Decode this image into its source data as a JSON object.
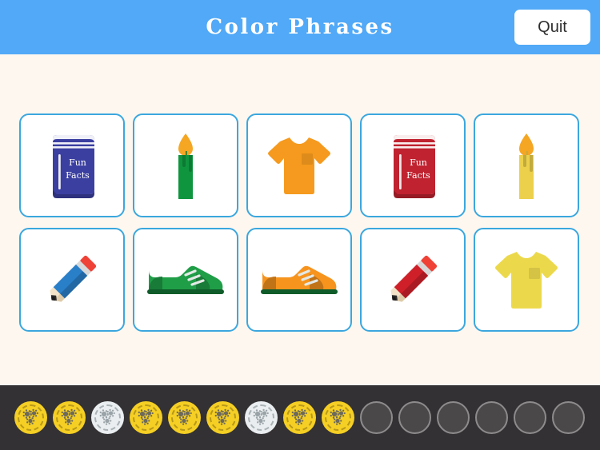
{
  "header": {
    "title": "Color Phrases",
    "quit_label": "Quit",
    "background_color": "#51a9f7",
    "title_color": "#ffffff"
  },
  "board": {
    "background_color": "#fdf7f0",
    "card_border_color": "#3ba7de",
    "card_background_color": "#ffffff",
    "columns": 5,
    "rows": 2,
    "cards": [
      {
        "id": "card-1",
        "icon": "book-icon",
        "icon_label": "Fun Facts",
        "color_name": "blue",
        "color": "#3b3fa0"
      },
      {
        "id": "card-2",
        "icon": "candle-icon",
        "icon_label": "",
        "color_name": "green",
        "color": "#10953f"
      },
      {
        "id": "card-3",
        "icon": "tshirt-icon",
        "icon_label": "",
        "color_name": "orange",
        "color": "#f59a1e"
      },
      {
        "id": "card-4",
        "icon": "book-icon",
        "icon_label": "Fun Facts",
        "color_name": "red",
        "color": "#c0222f"
      },
      {
        "id": "card-5",
        "icon": "candle-icon",
        "icon_label": "",
        "color_name": "yellow",
        "color": "#ecd04b"
      },
      {
        "id": "card-6",
        "icon": "pencil-icon",
        "icon_label": "",
        "color_name": "blue",
        "color": "#2a7fc9"
      },
      {
        "id": "card-7",
        "icon": "sneaker-icon",
        "icon_label": "",
        "color_name": "green",
        "color": "#1f9e47"
      },
      {
        "id": "card-8",
        "icon": "sneaker-icon",
        "icon_label": "",
        "color_name": "orange",
        "color": "#f7941e"
      },
      {
        "id": "card-9",
        "icon": "pencil-icon",
        "icon_label": "",
        "color_name": "red",
        "color": "#cf2029"
      },
      {
        "id": "card-10",
        "icon": "tshirt-icon",
        "icon_label": "",
        "color_name": "yellow",
        "color": "#ecd94b"
      }
    ]
  },
  "footer": {
    "background_color": "#333133",
    "coins": [
      {
        "state": "gold"
      },
      {
        "state": "gold"
      },
      {
        "state": "silver"
      },
      {
        "state": "gold"
      },
      {
        "state": "gold"
      },
      {
        "state": "gold"
      },
      {
        "state": "silver"
      },
      {
        "state": "gold"
      },
      {
        "state": "gold"
      },
      {
        "state": "empty"
      },
      {
        "state": "empty"
      },
      {
        "state": "empty"
      },
      {
        "state": "empty"
      },
      {
        "state": "empty"
      },
      {
        "state": "empty"
      }
    ],
    "earned_count": 9,
    "total_count": 15,
    "gold_color": "#f5cf24",
    "silver_color": "#eaeef0",
    "empty_color": "#4b4849"
  }
}
